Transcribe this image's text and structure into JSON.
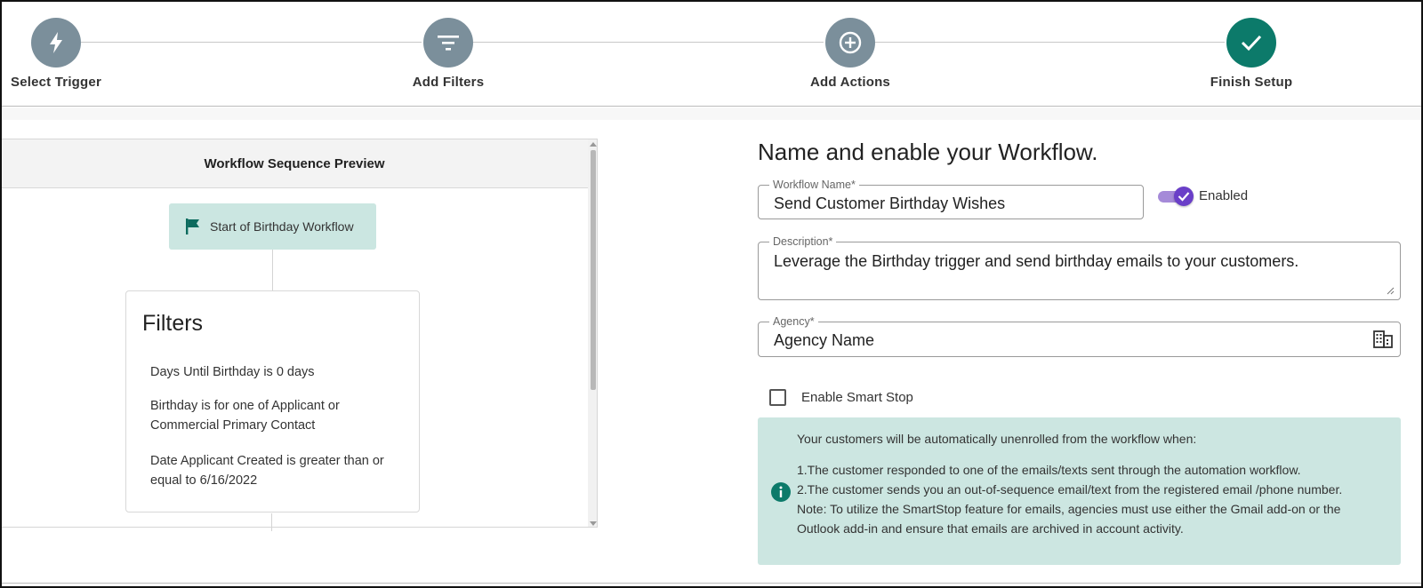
{
  "stepper": {
    "steps": [
      {
        "label": "Select Trigger",
        "icon": "bolt-icon",
        "state": "complete"
      },
      {
        "label": "Add Filters",
        "icon": "filter-icon",
        "state": "complete"
      },
      {
        "label": "Add Actions",
        "icon": "plus-circle-icon",
        "state": "complete"
      },
      {
        "label": "Finish Setup",
        "icon": "check-icon",
        "state": "active"
      }
    ],
    "colors": {
      "step": "#7b8f9b",
      "active": "#0c7a6a"
    }
  },
  "preview": {
    "title": "Workflow Sequence Preview",
    "start_node": "Start of Birthday Workflow",
    "filters": {
      "title": "Filters",
      "items": [
        "Days Until Birthday is 0 days",
        "Birthday is for one of Applicant or Commercial Primary Contact",
        "Date Applicant Created is greater than or equal to 6/16/2022"
      ]
    }
  },
  "form": {
    "title": "Name and enable your Workflow.",
    "workflow_name": {
      "label": "Workflow Name*",
      "value": "Send Customer Birthday Wishes"
    },
    "enabled": {
      "label": "Enabled",
      "checked": true
    },
    "description": {
      "label": "Description*",
      "value": "Leverage the Birthday trigger and send birthday emails to your customers."
    },
    "agency": {
      "label": "Agency*",
      "value": "Agency Name"
    },
    "smart_stop": {
      "label": "Enable Smart Stop",
      "checked": false
    },
    "info": {
      "lines": [
        "Your customers will be automatically unenrolled from the workflow when:",
        "1.The customer responded to one of the emails/texts sent through the automation workflow.",
        "2.The customer sends you an out-of-sequence email/text from the registered email /phone number.",
        "Note: To utilize the SmartStop feature for emails, agencies must use either the Gmail add-on or the",
        "Outlook add-in and ensure that emails are archived in account activity."
      ]
    }
  },
  "colors": {
    "accent_teal": "#0c7a6a",
    "info_bg": "#cce6e1",
    "toggle_purple": "#6a3fc8"
  }
}
